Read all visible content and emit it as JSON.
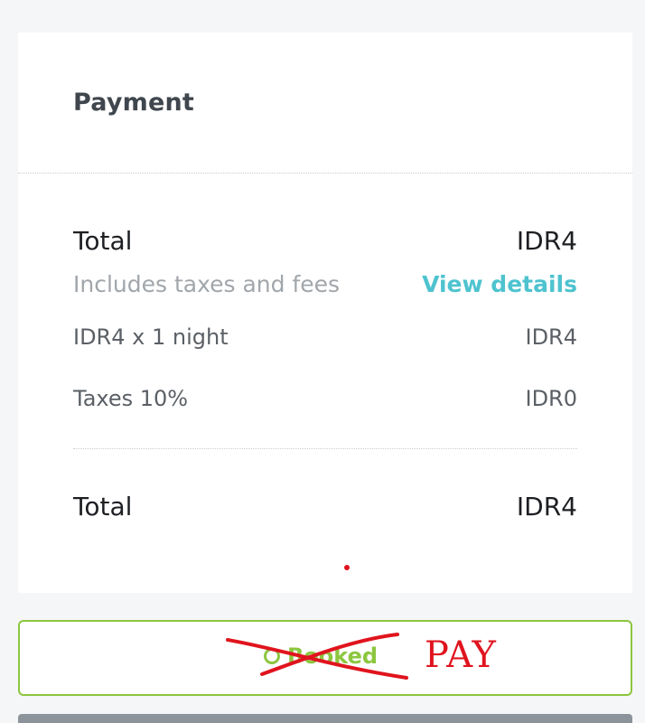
{
  "payment": {
    "title": "Payment",
    "total_label": "Total",
    "total_value": "IDR4",
    "taxes_note": "Includes taxes and fees",
    "view_details": "View details",
    "lines": [
      {
        "label": "IDR4 x 1 night",
        "value": "IDR4"
      },
      {
        "label": "Taxes 10%",
        "value": "IDR0"
      }
    ],
    "grand_total_label": "Total",
    "grand_total_value": "IDR4"
  },
  "action": {
    "booked_label": "Booked",
    "annotation_text": "PAY"
  },
  "colors": {
    "accent_link": "#4ec3cf",
    "booked_green": "#8cc63f",
    "annotation_red": "#e0141e"
  }
}
